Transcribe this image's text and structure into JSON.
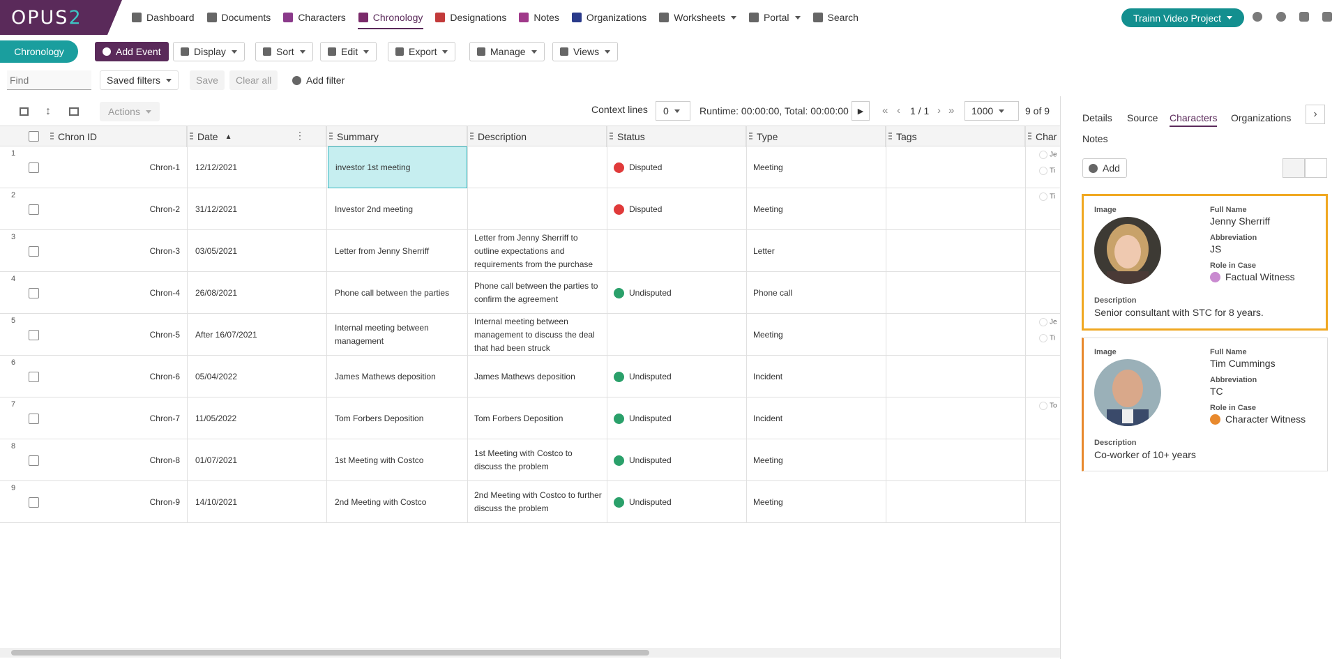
{
  "app": {
    "logo_main": "OPUS",
    "logo_num": "2"
  },
  "nav": [
    {
      "label": "Dashboard",
      "icon": "home-icon",
      "color": "#666"
    },
    {
      "label": "Documents",
      "icon": "file-icon",
      "color": "#666"
    },
    {
      "label": "Characters",
      "icon": "users-icon",
      "color": "#8a3a8a"
    },
    {
      "label": "Chronology",
      "icon": "calendar-icon",
      "color": "#7a2a6a",
      "active": true
    },
    {
      "label": "Designations",
      "icon": "list-icon",
      "color": "#c23a3a"
    },
    {
      "label": "Notes",
      "icon": "note-icon",
      "color": "#a03a8a"
    },
    {
      "label": "Organizations",
      "icon": "building-icon",
      "color": "#2a3a8a"
    },
    {
      "label": "Worksheets",
      "icon": "grid-icon",
      "color": "#666",
      "dropdown": true
    },
    {
      "label": "Portal",
      "icon": "globe-icon",
      "color": "#666",
      "dropdown": true
    },
    {
      "label": "Search",
      "icon": "search-icon",
      "color": "#666"
    }
  ],
  "project": {
    "label": "Trainn Video Project"
  },
  "toolbar": {
    "chronology": "Chronology",
    "add_event": "Add Event",
    "display": "Display",
    "sort": "Sort",
    "edit": "Edit",
    "export": "Export",
    "manage": "Manage",
    "views": "Views"
  },
  "filters": {
    "find_placeholder": "Find",
    "saved_filters": "Saved filters",
    "save": "Save",
    "clear_all": "Clear all",
    "add_filter": "Add filter"
  },
  "gridbar": {
    "actions": "Actions",
    "context_lines_label": "Context lines",
    "context_lines_value": "0",
    "runtime": "Runtime: 00:00:00, Total: 00:00:00",
    "page": "1 / 1",
    "page_size": "1000",
    "count": "9 of 9"
  },
  "columns": [
    "Chron ID",
    "Date",
    "Summary",
    "Description",
    "Status",
    "Type",
    "Tags",
    "Char"
  ],
  "status_colors": {
    "Disputed": "#e03a3a",
    "Undisputed": "#2aa06a"
  },
  "rows": [
    {
      "n": "1",
      "id": "Chron-1",
      "date": "12/12/2021",
      "summary": "investor 1st meeting",
      "description": "",
      "status": "Disputed",
      "type": "Meeting",
      "chars": [
        "Je",
        "Ti"
      ]
    },
    {
      "n": "2",
      "id": "Chron-2",
      "date": "31/12/2021",
      "summary": "Investor 2nd meeting",
      "description": "",
      "status": "Disputed",
      "type": "Meeting",
      "chars": [
        "Ti"
      ]
    },
    {
      "n": "3",
      "id": "Chron-3",
      "date": "03/05/2021",
      "summary": "Letter from Jenny Sherriff",
      "description": "Letter from Jenny Sherriff to outline expectations and requirements from the purchase",
      "status": "",
      "type": "Letter",
      "chars": []
    },
    {
      "n": "4",
      "id": "Chron-4",
      "date": "26/08/2021",
      "summary": "Phone call between the parties",
      "description": "Phone call between the parties to confirm the agreement",
      "status": "Undisputed",
      "type": "Phone call",
      "chars": []
    },
    {
      "n": "5",
      "id": "Chron-5",
      "date": "After 16/07/2021",
      "summary": "Internal meeting between management",
      "description": "Internal meeting between management to discuss the deal that had been struck",
      "status": "",
      "type": "Meeting",
      "chars": [
        "Je",
        "Ti"
      ]
    },
    {
      "n": "6",
      "id": "Chron-6",
      "date": "05/04/2022",
      "summary": "James Mathews deposition",
      "description": "James Mathews deposition",
      "status": "Undisputed",
      "type": "Incident",
      "chars": []
    },
    {
      "n": "7",
      "id": "Chron-7",
      "date": "11/05/2022",
      "summary": "Tom Forbers Deposition",
      "description": "Tom Forbers Deposition",
      "status": "Undisputed",
      "type": "Incident",
      "chars": [
        "To"
      ]
    },
    {
      "n": "8",
      "id": "Chron-8",
      "date": "01/07/2021",
      "summary": "1st Meeting with Costco",
      "description": "1st Meeting with Costco to discuss the problem",
      "status": "Undisputed",
      "type": "Meeting",
      "chars": []
    },
    {
      "n": "9",
      "id": "Chron-9",
      "date": "14/10/2021",
      "summary": "2nd Meeting with Costco",
      "description": "2nd Meeting with Costco to further discuss the problem",
      "status": "Undisputed",
      "type": "Meeting",
      "chars": []
    }
  ],
  "side": {
    "tabs": [
      "Details",
      "Source",
      "Characters",
      "Organizations",
      "Notes"
    ],
    "active_tab": "Characters",
    "add": "Add",
    "labels": {
      "image": "Image",
      "full_name": "Full Name",
      "abbreviation": "Abbreviation",
      "role": "Role in Case",
      "description": "Description"
    },
    "cards": [
      {
        "name": "Jenny Sherriff",
        "abbr": "JS",
        "role": "Factual Witness",
        "role_color": "#c98ad0",
        "description": "Senior consultant with STC for 8 years."
      },
      {
        "name": "Tim Cummings",
        "abbr": "TC",
        "role": "Character Witness",
        "role_color": "#e8892d",
        "description": "Co-worker of 10+ years"
      }
    ]
  }
}
